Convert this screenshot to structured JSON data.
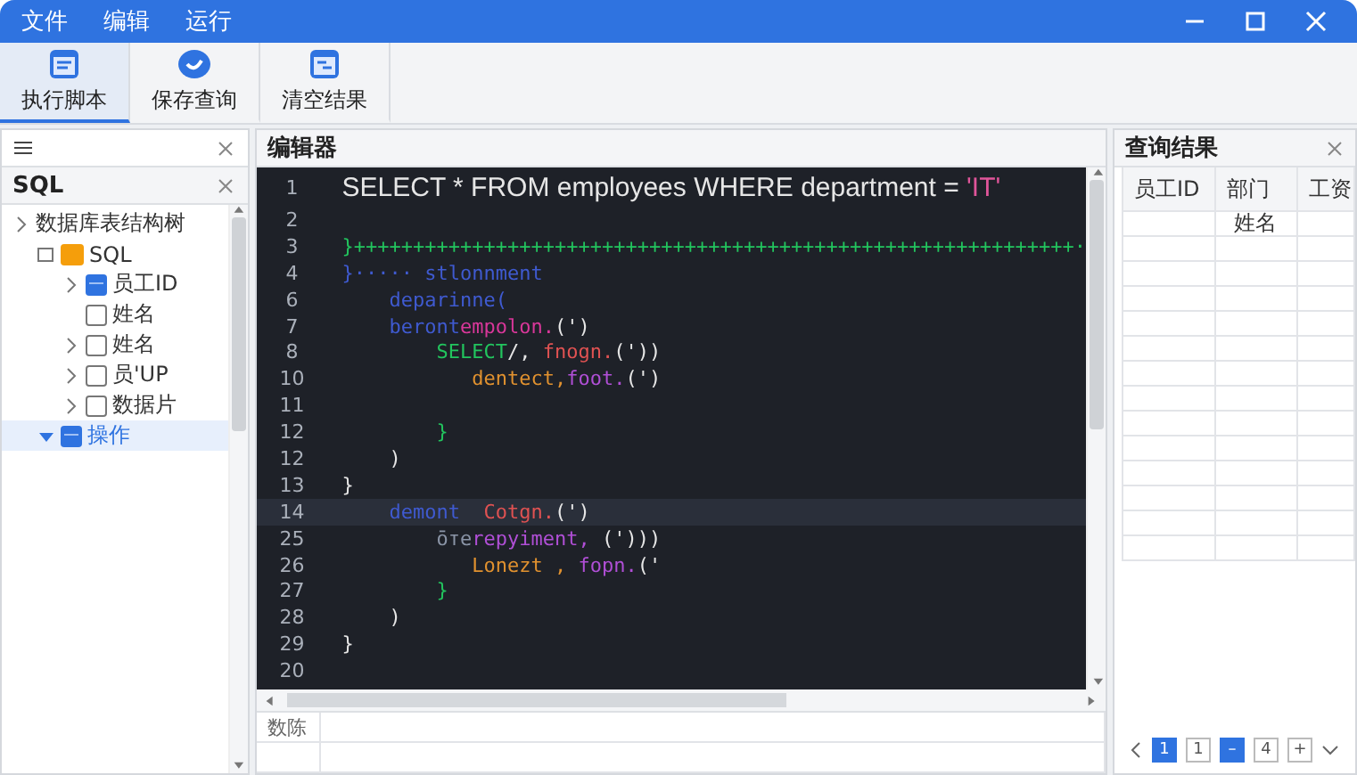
{
  "menu": [
    "文件",
    "编辑",
    "运行"
  ],
  "toolbar": [
    {
      "label": "执行脚本",
      "selected": true
    },
    {
      "label": "保存查询",
      "selected": false
    },
    {
      "label": "清空结果",
      "selected": false
    }
  ],
  "left_panel": {
    "tab_title": "SQL",
    "tree": [
      {
        "label": "数据库表结构树",
        "expanded": false,
        "children": [
          {
            "label": "SQL",
            "kind": "database",
            "expanded": true,
            "children": [
              {
                "label": "员工ID",
                "kind": "table",
                "expanded": false
              },
              {
                "label": "姓名",
                "kind": "checkbox"
              },
              {
                "label": "姓名",
                "kind": "checkbox",
                "expanded": false
              },
              {
                "label": "员'UP",
                "kind": "checkbox",
                "expanded": false
              },
              {
                "label": "数据片",
                "kind": "checkbox",
                "expanded": false
              }
            ]
          },
          {
            "label": "操作",
            "kind": "table",
            "expanded": true,
            "selected": true
          }
        ]
      }
    ]
  },
  "editor": {
    "title": "编辑器",
    "lines": [
      {
        "number": "1",
        "big": true,
        "tokens": [
          {
            "text": "SELECT * FROM employees WHERE department = ",
            "kind": "plain"
          },
          {
            "text": "'IT'",
            "kind": "string"
          }
        ]
      },
      {
        "number": "2"
      },
      {
        "number": "3",
        "tokens": [
          {
            "text": "}+++++++++++++++++++++++++++++++++++++++++++++++++++++++++++++·",
            "kind": "green"
          }
        ]
      },
      {
        "number": "4",
        "tokens": [
          {
            "text": "}····· ",
            "kind": "blue"
          },
          {
            "text": "stlonnment",
            "kind": "blue"
          }
        ]
      },
      {
        "number": "6",
        "tokens": [
          {
            "text": "    deparinne(",
            "kind": "blue"
          }
        ]
      },
      {
        "number": "7",
        "tokens": [
          {
            "text": "    beront",
            "kind": "blue"
          },
          {
            "text": "empolon.",
            "kind": "pink"
          },
          {
            "text": "(')",
            "kind": "plain"
          }
        ]
      },
      {
        "number": "8",
        "tokens": [
          {
            "text": "        SELECT",
            "kind": "green"
          },
          {
            "text": "/, ",
            "kind": "plain"
          },
          {
            "text": "fnogn.",
            "kind": "red"
          },
          {
            "text": "('))",
            "kind": "plain"
          }
        ]
      },
      {
        "number": "10",
        "tokens": [
          {
            "text": "           dentect,",
            "kind": "orange"
          },
          {
            "text": "foot.",
            "kind": "purple"
          },
          {
            "text": "(')",
            "kind": "plain"
          }
        ]
      },
      {
        "number": "11"
      },
      {
        "number": "12",
        "tokens": [
          {
            "text": "        }",
            "kind": "green"
          }
        ]
      },
      {
        "number": "12",
        "tokens": [
          {
            "text": "    )",
            "kind": "plain"
          }
        ]
      },
      {
        "number": "13",
        "tokens": [
          {
            "text": "}",
            "kind": "plain"
          }
        ]
      },
      {
        "number": "14",
        "current": true,
        "tokens": [
          {
            "text": "    demont  ",
            "kind": "blue"
          },
          {
            "text": "Cotgn.",
            "kind": "red"
          },
          {
            "text": "(')",
            "kind": "plain"
          }
        ]
      },
      {
        "number": "25",
        "tokens": [
          {
            "text": "        ōтe",
            "kind": "grey"
          },
          {
            "text": "repyiment, ",
            "kind": "purple"
          },
          {
            "text": "(')))",
            "kind": "plain"
          }
        ]
      },
      {
        "number": "26",
        "tokens": [
          {
            "text": "           Lonezt , ",
            "kind": "orange"
          },
          {
            "text": "fopn.",
            "kind": "purple"
          },
          {
            "text": "('",
            "kind": "plain"
          }
        ]
      },
      {
        "number": "27",
        "tokens": [
          {
            "text": "        }",
            "kind": "green"
          }
        ]
      },
      {
        "number": "28",
        "tokens": [
          {
            "text": "    )",
            "kind": "plain"
          }
        ]
      },
      {
        "number": "29",
        "tokens": [
          {
            "text": "}",
            "kind": "plain"
          }
        ]
      },
      {
        "number": "20"
      }
    ],
    "bottom_table": {
      "rows": [
        [
          "数陈",
          ""
        ],
        [
          "",
          ""
        ]
      ]
    }
  },
  "results": {
    "title": "查询结果",
    "columns": [
      "员工ID",
      "部门",
      "工资"
    ],
    "rows": [
      [
        "",
        "姓名",
        ""
      ],
      [
        "",
        "",
        ""
      ],
      [
        "",
        "",
        ""
      ],
      [
        "",
        "",
        ""
      ],
      [
        "",
        "",
        ""
      ],
      [
        "",
        "",
        ""
      ],
      [
        "",
        "",
        ""
      ],
      [
        "",
        "",
        ""
      ],
      [
        "",
        "",
        ""
      ],
      [
        "",
        "",
        ""
      ],
      [
        "",
        "",
        ""
      ],
      [
        "",
        "",
        ""
      ],
      [
        "",
        "",
        ""
      ],
      [
        "",
        "",
        ""
      ]
    ],
    "pagination": [
      {
        "label": "1",
        "selected": true
      },
      {
        "label": "1",
        "selected": false
      },
      {
        "label": "–",
        "selected": true
      },
      {
        "label": "4",
        "selected": false
      },
      {
        "label": "+",
        "selected": false
      }
    ]
  }
}
